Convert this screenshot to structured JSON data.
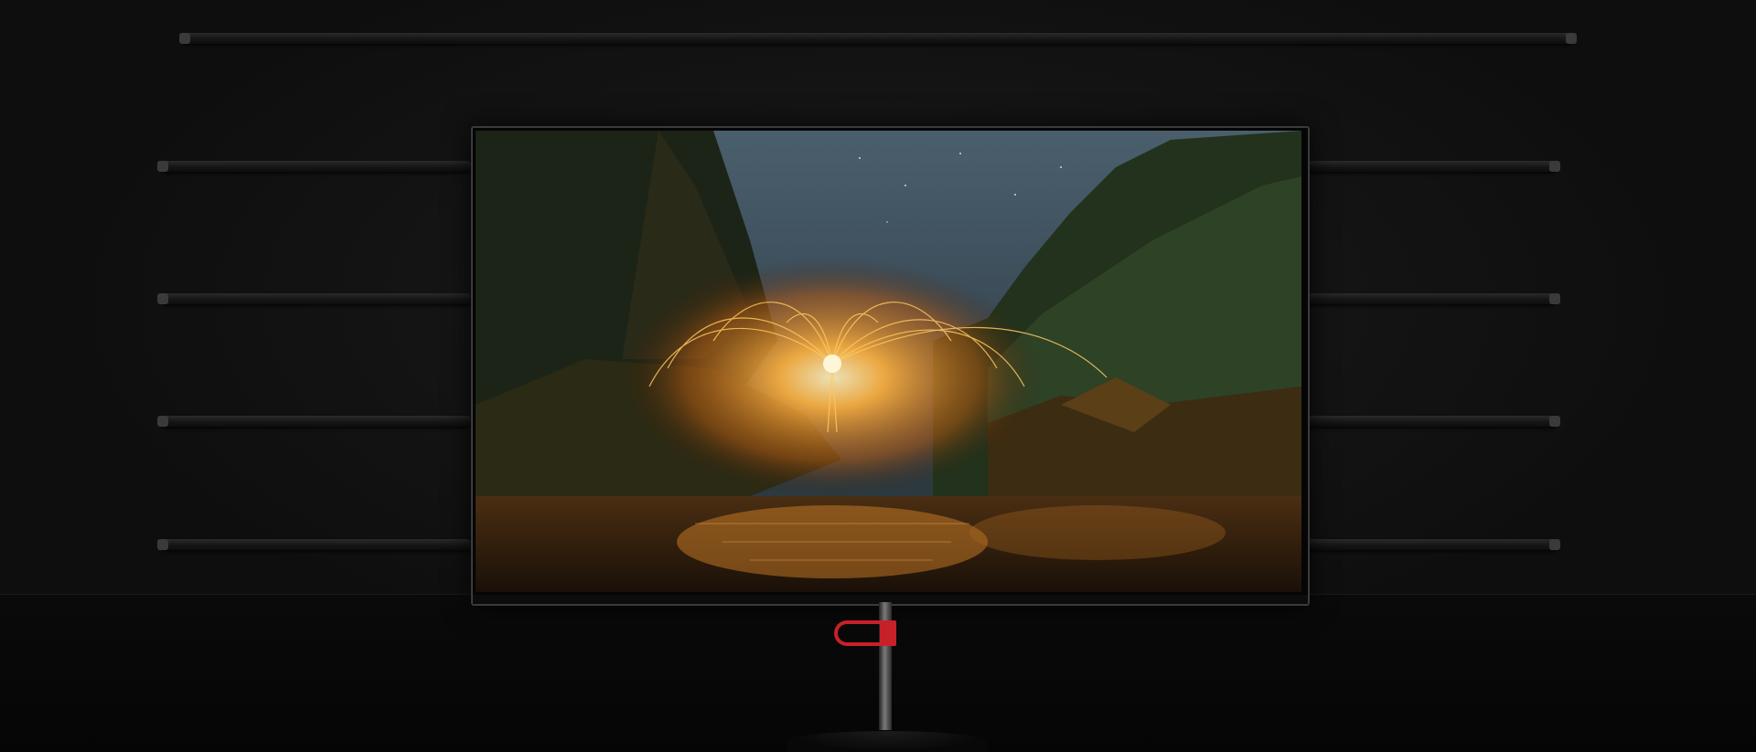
{
  "scene": {
    "subject": "monitor",
    "accent_color": "#c8202a",
    "background_color": "#0b0b0b"
  },
  "screen_image": {
    "subject": "steel-wool-light-painting-night-forest-stream",
    "palette": {
      "sky": "#33414c",
      "forest": "#2a3b22",
      "glow": "#ffb340",
      "water": "#3a2410"
    }
  },
  "icons": {
    "clip": "stand-cable-clip-icon"
  }
}
